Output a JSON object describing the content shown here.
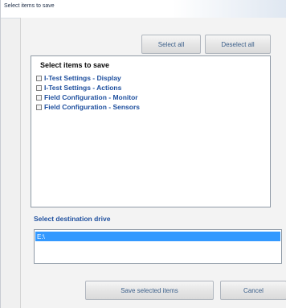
{
  "window": {
    "title": "Select items to save"
  },
  "toolbar": {
    "select_all_label": "Select all",
    "deselect_all_label": "Deselect all"
  },
  "items_list": {
    "header": "Select items to save",
    "items": [
      {
        "label": "I-Test Settings - Display",
        "checked": false
      },
      {
        "label": "I-Test Settings - Actions",
        "checked": false
      },
      {
        "label": "Field Configuration - Monitor",
        "checked": false
      },
      {
        "label": "Field Configuration - Sensors",
        "checked": false
      }
    ]
  },
  "destination": {
    "label": "Select destination drive",
    "drives": [
      {
        "label": "E:\\",
        "selected": true
      }
    ]
  },
  "footer": {
    "save_label": "Save selected items",
    "cancel_label": "Cancel"
  },
  "colors": {
    "item_text": "#1e4f9e",
    "selection": "#3399ff"
  }
}
